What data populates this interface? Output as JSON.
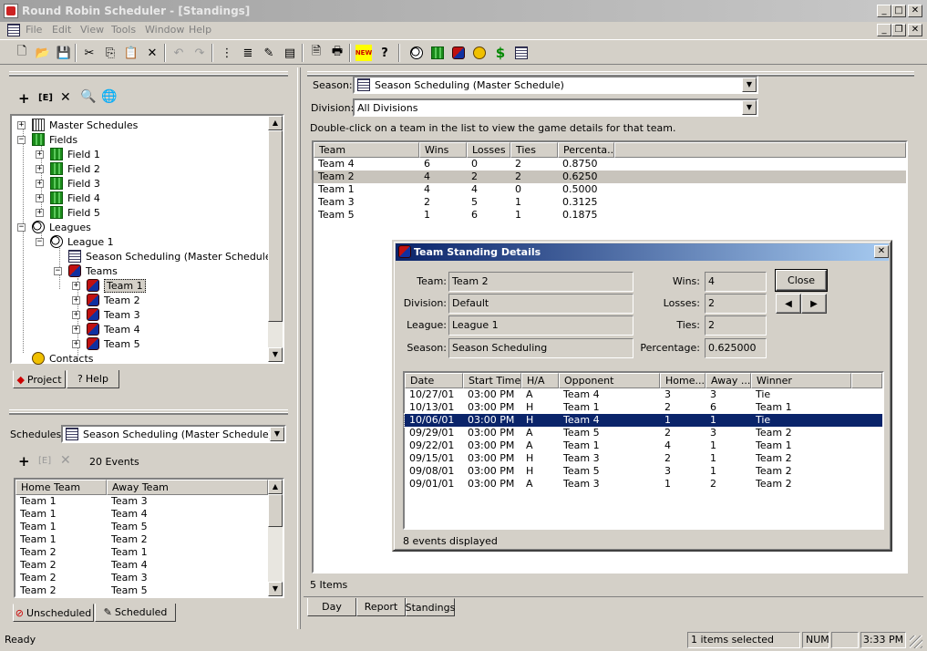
{
  "app": {
    "title": "Round Robin Scheduler - [Standings]"
  },
  "menu": [
    "File",
    "Edit",
    "View",
    "Tools",
    "Window",
    "Help"
  ],
  "toolbar_icons": [
    "new-icon",
    "open-icon",
    "save-icon",
    "cut-icon",
    "copy-icon",
    "paste-icon",
    "delete-icon",
    "undo-icon",
    "redo-icon",
    "view1-icon",
    "view2-icon",
    "view3-icon",
    "view4-icon",
    "print-preview-icon",
    "print-icon",
    "new-badge-icon",
    "help-icon",
    "soccer-icon",
    "field-icon",
    "team-icon",
    "contact-icon",
    "dollar-icon",
    "schedule-icon"
  ],
  "project_tree": {
    "toolbar": {
      "edit_label": "[E]"
    },
    "nodes": [
      {
        "label": "Master Schedules"
      },
      {
        "label": "Fields"
      },
      {
        "label": "Field 1"
      },
      {
        "label": "Field 2"
      },
      {
        "label": "Field 3"
      },
      {
        "label": "Field 4"
      },
      {
        "label": "Field 5"
      },
      {
        "label": "Leagues"
      },
      {
        "label": "League 1"
      },
      {
        "label": "Season Scheduling (Master Schedule)"
      },
      {
        "label": "Teams"
      },
      {
        "label": "Team 1"
      },
      {
        "label": "Team 2"
      },
      {
        "label": "Team 3"
      },
      {
        "label": "Team 4"
      },
      {
        "label": "Team 5"
      },
      {
        "label": "Contacts"
      }
    ],
    "tabs": [
      {
        "label": "Project"
      },
      {
        "label": "Help"
      }
    ]
  },
  "schedules_panel": {
    "label": "Schedules:",
    "selected": "Season Scheduling (Master Schedule)",
    "edit_label": "[E]",
    "events_count": "20 Events",
    "columns": [
      "Home Team",
      "Away Team"
    ],
    "rows": [
      [
        "Team 1",
        "Team 3"
      ],
      [
        "Team 1",
        "Team 4"
      ],
      [
        "Team 1",
        "Team 5"
      ],
      [
        "Team 1",
        "Team 2"
      ],
      [
        "Team 2",
        "Team 1"
      ],
      [
        "Team 2",
        "Team 4"
      ],
      [
        "Team 2",
        "Team 3"
      ],
      [
        "Team 2",
        "Team 5"
      ]
    ],
    "tabs": [
      {
        "label": "Unscheduled"
      },
      {
        "label": "Scheduled"
      }
    ]
  },
  "standings": {
    "season_label": "Season:",
    "season_value": "Season Scheduling (Master Schedule)",
    "division_label": "Division:",
    "division_value": "All Divisions",
    "hint": "Double-click on a team in the list to view the game details for that team.",
    "columns": [
      "Team",
      "Wins",
      "Losses",
      "Ties",
      "Percenta..."
    ],
    "rows": [
      [
        "Team 4",
        "6",
        "0",
        "2",
        "0.8750"
      ],
      [
        "Team 2",
        "4",
        "2",
        "2",
        "0.6250"
      ],
      [
        "Team 1",
        "4",
        "4",
        "0",
        "0.5000"
      ],
      [
        "Team 3",
        "2",
        "5",
        "1",
        "0.3125"
      ],
      [
        "Team 5",
        "1",
        "6",
        "1",
        "0.1875"
      ]
    ],
    "item_count": "5 Items",
    "tabs": [
      {
        "label": "Day"
      },
      {
        "label": "Report"
      },
      {
        "label": "Standings"
      }
    ]
  },
  "dialog": {
    "title": "Team Standing Details",
    "team_label": "Team:",
    "team_value": "Team 2",
    "division_label": "Division:",
    "division_value": "Default",
    "league_label": "League:",
    "league_value": "League 1",
    "season_label": "Season:",
    "season_value": "Season Scheduling",
    "wins_label": "Wins:",
    "wins_value": "4",
    "losses_label": "Losses:",
    "losses_value": "2",
    "ties_label": "Ties:",
    "ties_value": "2",
    "percentage_label": "Percentage:",
    "percentage_value": "0.625000",
    "close_label": "Close",
    "columns": [
      "Date",
      "Start Time",
      "H/A",
      "Opponent",
      "Home...",
      "Away ...",
      "Winner"
    ],
    "rows": [
      [
        "10/27/01",
        "03:00 PM",
        "A",
        "Team 4",
        "3",
        "3",
        "Tie"
      ],
      [
        "10/13/01",
        "03:00 PM",
        "H",
        "Team 1",
        "2",
        "6",
        "Team 1"
      ],
      [
        "10/06/01",
        "03:00 PM",
        "H",
        "Team 4",
        "1",
        "1",
        "Tie"
      ],
      [
        "09/29/01",
        "03:00 PM",
        "A",
        "Team 5",
        "2",
        "3",
        "Team 2"
      ],
      [
        "09/22/01",
        "03:00 PM",
        "A",
        "Team 1",
        "4",
        "1",
        "Team 1"
      ],
      [
        "09/15/01",
        "03:00 PM",
        "H",
        "Team 3",
        "2",
        "1",
        "Team 2"
      ],
      [
        "09/08/01",
        "03:00 PM",
        "H",
        "Team 5",
        "3",
        "1",
        "Team 2"
      ],
      [
        "09/01/01",
        "03:00 PM",
        "A",
        "Team 3",
        "1",
        "2",
        "Team 2"
      ]
    ],
    "events_displayed": "8 events displayed"
  },
  "statusbar": {
    "ready": "Ready",
    "selection": "1 items selected",
    "num": "NUM",
    "time": "3:33 PM"
  }
}
